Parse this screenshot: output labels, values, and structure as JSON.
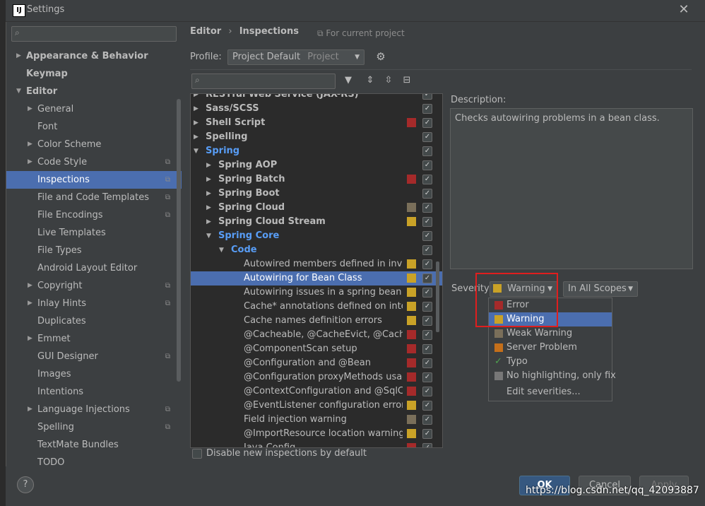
{
  "window": {
    "title": "Settings",
    "app_icon": "IJ",
    "close": "✕"
  },
  "sidebar": {
    "items": [
      {
        "label": "Appearance & Behavior",
        "level": 0,
        "bold": true,
        "arrow": "▶"
      },
      {
        "label": "Keymap",
        "level": 0,
        "bold": true,
        "arrow": ""
      },
      {
        "label": "Editor",
        "level": 0,
        "bold": true,
        "arrow": "▼"
      },
      {
        "label": "General",
        "level": 1,
        "arrow": "▶"
      },
      {
        "label": "Font",
        "level": 1,
        "arrow": ""
      },
      {
        "label": "Color Scheme",
        "level": 1,
        "arrow": "▶"
      },
      {
        "label": "Code Style",
        "level": 1,
        "arrow": "▶",
        "copy": true
      },
      {
        "label": "Inspections",
        "level": 1,
        "arrow": "",
        "copy": true,
        "selected": true
      },
      {
        "label": "File and Code Templates",
        "level": 1,
        "arrow": "",
        "copy": true
      },
      {
        "label": "File Encodings",
        "level": 1,
        "arrow": "",
        "copy": true
      },
      {
        "label": "Live Templates",
        "level": 1,
        "arrow": ""
      },
      {
        "label": "File Types",
        "level": 1,
        "arrow": ""
      },
      {
        "label": "Android Layout Editor",
        "level": 1,
        "arrow": ""
      },
      {
        "label": "Copyright",
        "level": 1,
        "arrow": "▶",
        "copy": true
      },
      {
        "label": "Inlay Hints",
        "level": 1,
        "arrow": "▶",
        "copy": true
      },
      {
        "label": "Duplicates",
        "level": 1,
        "arrow": ""
      },
      {
        "label": "Emmet",
        "level": 1,
        "arrow": "▶"
      },
      {
        "label": "GUI Designer",
        "level": 1,
        "arrow": "",
        "copy": true
      },
      {
        "label": "Images",
        "level": 1,
        "arrow": ""
      },
      {
        "label": "Intentions",
        "level": 1,
        "arrow": ""
      },
      {
        "label": "Language Injections",
        "level": 1,
        "arrow": "▶",
        "copy": true
      },
      {
        "label": "Spelling",
        "level": 1,
        "arrow": "",
        "copy": true
      },
      {
        "label": "TextMate Bundles",
        "level": 1,
        "arrow": ""
      },
      {
        "label": "TODO",
        "level": 1,
        "arrow": ""
      }
    ]
  },
  "breadcrumb": {
    "first": "Editor",
    "sep": "›",
    "second": "Inspections",
    "scope_icon": "⧉",
    "scope": "For current project"
  },
  "profile": {
    "label": "Profile:",
    "value": "Project Default",
    "hint": "Project"
  },
  "inspections": [
    {
      "label": "RESTful Web Service (JAX-RS)",
      "level": 0,
      "bold": true,
      "arrow": "▶",
      "color": ""
    },
    {
      "label": "Sass/SCSS",
      "level": 0,
      "bold": true,
      "arrow": "▶",
      "color": ""
    },
    {
      "label": "Shell Script",
      "level": 0,
      "bold": true,
      "arrow": "▶",
      "color": "#a52a2a"
    },
    {
      "label": "Spelling",
      "level": 0,
      "bold": true,
      "arrow": "▶",
      "color": ""
    },
    {
      "label": "Spring",
      "level": 0,
      "bold": true,
      "arrow": "▼",
      "color": "",
      "blue": true
    },
    {
      "label": "Spring AOP",
      "level": 1,
      "bold": true,
      "arrow": "▶",
      "color": ""
    },
    {
      "label": "Spring Batch",
      "level": 1,
      "bold": true,
      "arrow": "▶",
      "color": "#a52a2a"
    },
    {
      "label": "Spring Boot",
      "level": 1,
      "bold": true,
      "arrow": "▶",
      "color": ""
    },
    {
      "label": "Spring Cloud",
      "level": 1,
      "bold": true,
      "arrow": "▶",
      "color": "#7a6f5a"
    },
    {
      "label": "Spring Cloud Stream",
      "level": 1,
      "bold": true,
      "arrow": "▶",
      "color": "#c9a227"
    },
    {
      "label": "Spring Core",
      "level": 1,
      "bold": true,
      "arrow": "▼",
      "color": "",
      "blue": true
    },
    {
      "label": "Code",
      "level": 2,
      "bold": true,
      "arrow": "▼",
      "color": "",
      "blue": true
    },
    {
      "label": "Autowired members defined in invalid Spring bean",
      "level": 3,
      "color": "#c9a227"
    },
    {
      "label": "Autowiring for Bean Class",
      "level": 3,
      "color": "#c9a227",
      "selected": true
    },
    {
      "label": "Autowiring issues in a spring bean class",
      "level": 3,
      "color": "#c9a227"
    },
    {
      "label": "Cache* annotations defined on interface",
      "level": 3,
      "color": "#c9a227"
    },
    {
      "label": "Cache names definition errors",
      "level": 3,
      "color": "#c9a227"
    },
    {
      "label": "@Cacheable, @CacheEvict, @CachePut, @Caching",
      "level": 3,
      "color": "#a52a2a"
    },
    {
      "label": "@ComponentScan setup",
      "level": 3,
      "color": "#a52a2a"
    },
    {
      "label": "@Configuration and @Bean",
      "level": 3,
      "color": "#a52a2a"
    },
    {
      "label": "@Configuration proxyMethods usage warnings",
      "level": 3,
      "color": "#a52a2a"
    },
    {
      "label": "@ContextConfiguration and @SqlConfig",
      "level": 3,
      "color": "#a52a2a"
    },
    {
      "label": "@EventListener configuration error",
      "level": 3,
      "color": "#c9a227"
    },
    {
      "label": "Field injection warning",
      "level": 3,
      "color": "#7a6f5a"
    },
    {
      "label": "@ImportResource location warnings",
      "level": 3,
      "color": "#c9a227"
    },
    {
      "label": "Java Config",
      "level": 3,
      "color": "#a52a2a"
    }
  ],
  "description": {
    "label": "Description:",
    "text": "Checks autowiring problems in a bean class."
  },
  "severity": {
    "label": "Severity:",
    "value": "Warning",
    "value_color": "#c9a227",
    "scope": "In All Scopes"
  },
  "severity_popup": [
    {
      "label": "Error",
      "color": "#a52a2a"
    },
    {
      "label": "Warning",
      "color": "#c9a227",
      "selected": true
    },
    {
      "label": "Weak Warning",
      "color": "#7a6f5a"
    },
    {
      "label": "Server Problem",
      "color": "#c46f1a"
    },
    {
      "label": "Typo",
      "color": "",
      "icon": "✓"
    },
    {
      "label": "No highlighting, only fix",
      "color": "#777777"
    },
    {
      "label": "Edit severities...",
      "color": "",
      "separator": true
    }
  ],
  "disable_new": {
    "label": "Disable new inspections by default"
  },
  "buttons": {
    "ok": "OK",
    "cancel": "Cancel",
    "apply": "Apply",
    "help": "?"
  },
  "watermark": "https://blog.csdn.net/qq_42093887"
}
